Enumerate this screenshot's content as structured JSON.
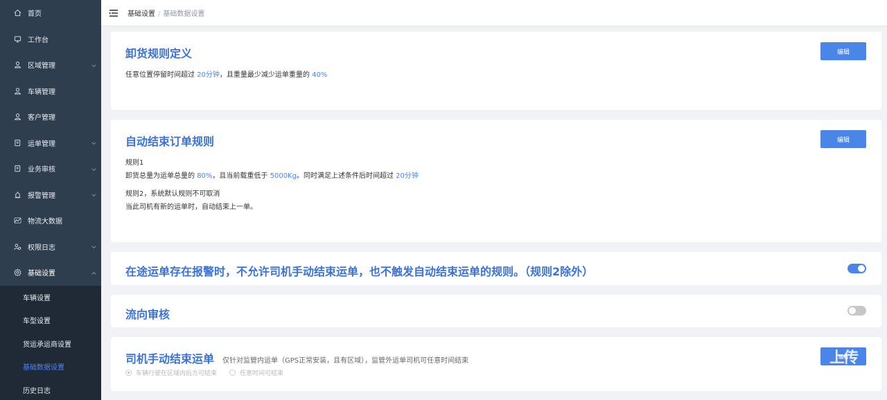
{
  "sidebar": {
    "items": [
      {
        "label": "首页",
        "icon": "home-icon",
        "has_children": false
      },
      {
        "label": "工作台",
        "icon": "monitor-icon",
        "has_children": false
      },
      {
        "label": "区域管理",
        "icon": "user-icon",
        "has_children": true
      },
      {
        "label": "车辆管理",
        "icon": "user-icon",
        "has_children": false
      },
      {
        "label": "客户管理",
        "icon": "user-icon",
        "has_children": false
      },
      {
        "label": "运单管理",
        "icon": "document-icon",
        "has_children": true
      },
      {
        "label": "业务审核",
        "icon": "document-icon",
        "has_children": true
      },
      {
        "label": "报警管理",
        "icon": "alarm-icon",
        "has_children": true
      },
      {
        "label": "物流大数据",
        "icon": "data-icon",
        "has_children": false
      },
      {
        "label": "权限日志",
        "icon": "users-icon",
        "has_children": true
      },
      {
        "label": "基础设置",
        "icon": "gear-icon",
        "has_children": true,
        "expanded": true
      }
    ],
    "subitems": [
      {
        "label": "车辆设置",
        "active": false
      },
      {
        "label": "车型设置",
        "active": false
      },
      {
        "label": "货运承运商设置",
        "active": false
      },
      {
        "label": "基础数据设置",
        "active": true
      },
      {
        "label": "历史日志",
        "active": false
      }
    ]
  },
  "header": {
    "breadcrumb_root": "基础设置",
    "breadcrumb_sep": "/",
    "breadcrumb_current": "基础数据设置"
  },
  "unload_rule": {
    "title": "卸货规则定义",
    "edit_label": "编辑",
    "text_a": "任意位置停留时间超过 ",
    "time": "20分钟",
    "text_b": "，且重量最少减少运单重量的 ",
    "percent": "40%"
  },
  "auto_end": {
    "title": "自动结束订单规则",
    "edit_label": "编辑",
    "rule1_title": "规则1",
    "r1_a": "卸货总量为运单总量的 ",
    "r1_percent": "80%",
    "r1_b": "，且当前载重低于 ",
    "r1_weight": "5000Kg",
    "r1_c": "。同时满足上述条件后时间超过 ",
    "r1_time": "20分钟",
    "rule2_title": "规则2，系统默认规则不可取消",
    "rule2_desc": "当此司机有新的运单时，自动结束上一单。"
  },
  "alarm_rule": {
    "title": "在途运单存在报警时，不允许司机手动结束运单，也不触发自动结束运单的规则。（规则2除外）",
    "enabled": true
  },
  "flow_review": {
    "title": "流向审核",
    "enabled": false
  },
  "manual_end": {
    "title": "司机手动结束运单",
    "note": "仅针对监管内运单（GPS正常安装，且有区域），监管外运单司机可任意时间结束",
    "option1": "车辆行驶在区域内后方可结束",
    "option2": "任意时间可结束",
    "button_overlay_text": "上传",
    "button_label": "编辑"
  },
  "colors": {
    "accent": "#4a86e8",
    "sidebar_bg": "#2f3e4e",
    "submenu_bg": "#1f2a36",
    "title_blue": "#3b73d8"
  }
}
